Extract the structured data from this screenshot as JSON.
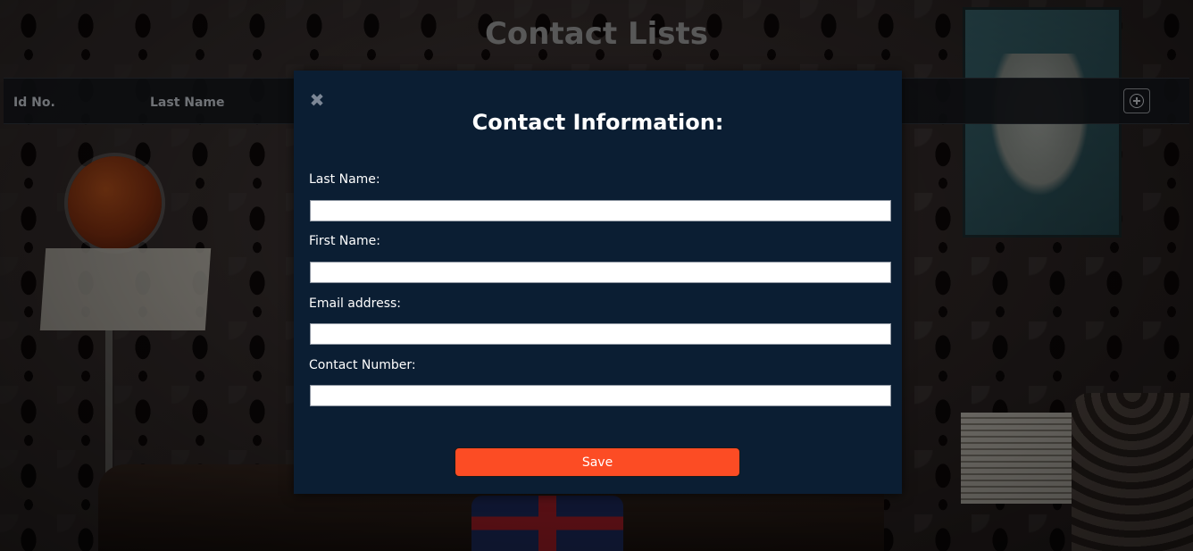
{
  "page": {
    "title": "Contact Lists"
  },
  "table": {
    "columns": [
      "Id No.",
      "Last Name"
    ],
    "add_icon": "plus-circle-icon"
  },
  "modal": {
    "close_icon": "close-icon",
    "close_glyph": "✖",
    "title": "Contact Information:",
    "fields": [
      {
        "label": "Last Name:",
        "value": "",
        "placeholder": ""
      },
      {
        "label": "First Name:",
        "value": "",
        "placeholder": ""
      },
      {
        "label": "Email address:",
        "value": "",
        "placeholder": ""
      },
      {
        "label": "Contact Number:",
        "value": "",
        "placeholder": ""
      }
    ],
    "save_label": "Save"
  },
  "colors": {
    "modal_bg": "#0b1e33",
    "save_button": "#fc4c24",
    "header_bar": "#14161a"
  }
}
